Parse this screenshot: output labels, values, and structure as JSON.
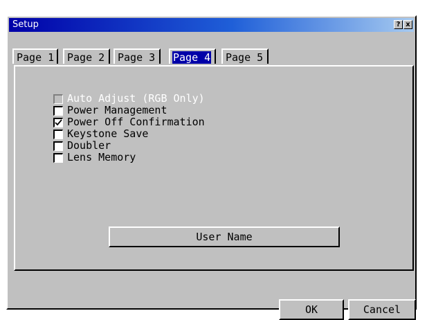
{
  "window": {
    "title": "Setup",
    "help_glyph": "?",
    "close_glyph": "x"
  },
  "tabs": [
    {
      "label": "Page 1",
      "active": false
    },
    {
      "label": "Page 2",
      "active": false
    },
    {
      "label": "Page 3",
      "active": false
    },
    {
      "label": "Page 4",
      "active": true
    },
    {
      "label": "Page 5",
      "active": false
    }
  ],
  "options": [
    {
      "label": "Auto Adjust (RGB Only)",
      "checked": false,
      "enabled": false
    },
    {
      "label": "Power Management",
      "checked": false,
      "enabled": true
    },
    {
      "label": "Power Off Confirmation",
      "checked": true,
      "enabled": true
    },
    {
      "label": "Keystone Save",
      "checked": false,
      "enabled": true
    },
    {
      "label": "Doubler",
      "checked": false,
      "enabled": true
    },
    {
      "label": "Lens Memory",
      "checked": false,
      "enabled": true
    }
  ],
  "buttons": {
    "user_name": "User Name",
    "ok": "OK",
    "cancel": "Cancel"
  },
  "colors": {
    "titlebar_start": "#0000a8",
    "titlebar_end": "#a6caf0",
    "face": "#c0c0c0",
    "selection": "#0000a8"
  }
}
